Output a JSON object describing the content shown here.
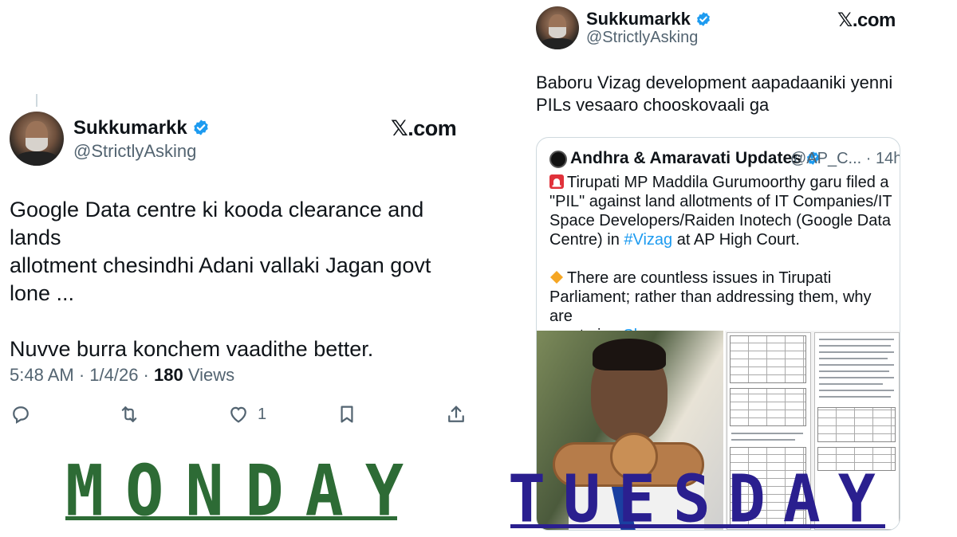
{
  "left_tweet": {
    "author_name": "Sukkumarkk",
    "author_handle": "@StrictlyAsking",
    "brand": "𝕏.com",
    "text_line1": "Google Data centre ki kooda clearance and lands",
    "text_line2": "allotment chesindhi Adani vallaki Jagan govt",
    "text_line3": "lone ...",
    "text_line4": "Nuvve burra konchem vaadithe better.",
    "timestamp": "5:48 AM · 1/4/26 · ",
    "views_count": "180",
    "views_label": " Views",
    "like_count": "1",
    "icons": [
      "reply-icon",
      "retweet-icon",
      "like-icon",
      "bookmark-icon",
      "share-icon"
    ]
  },
  "right_tweet": {
    "author_name": "Sukkumarkk",
    "author_handle": "@StrictlyAsking",
    "brand": "𝕏.com",
    "text_line1": "Baboru Vizag development aapadaaniki yenni",
    "text_line2": "PILs vesaaro chooskovaali ga",
    "quote": {
      "author_name": "Andhra & Amaravati Updates",
      "author_handle": "@AP_C... · 14h",
      "line1": "Tirupati MP Maddila Gurumoorthy garu filed a",
      "line2": "\"PIL\" against land allotments of IT Companies/IT",
      "line3": "Space Developers/Raiden Inotech (Google Data",
      "line4_pre": "Centre) in ",
      "line4_link": "#Vizag",
      "line4_post": " at AP High Court.",
      "line5": "There are countless issues in Tirupati",
      "line6": "Parliament; rather than addressing them, why are",
      "line7_pre": "you trying ",
      "line7_link": "Show more"
    }
  },
  "labels": {
    "monday": "MONDAY",
    "tuesday": "TUESDAY"
  },
  "colors": {
    "verified_blue": "#1d9bf0",
    "link_blue": "#1d9bf0",
    "monday_green": "#2d6b35",
    "tuesday_indigo": "#2a1f8f",
    "secondary_text": "#536471"
  }
}
